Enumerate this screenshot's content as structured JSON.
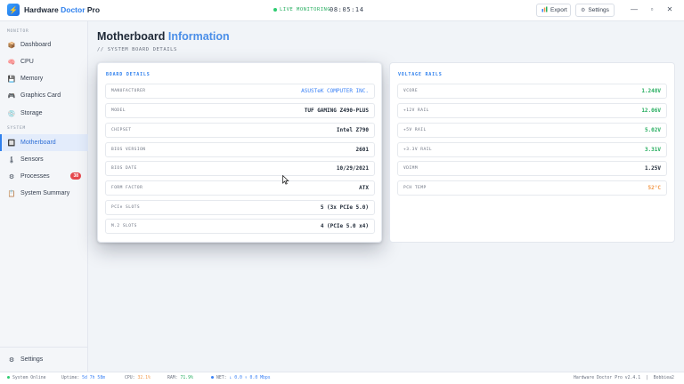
{
  "app": {
    "logo_glyph": "⚡",
    "title_prefix": "Hardware ",
    "title_accent": "Doctor",
    "title_suffix": " Pro",
    "accent_color": "#2f80ed"
  },
  "titlebar": {
    "live_label": "LIVE MONITORING",
    "clock": "08:05:14",
    "export_label": "Export",
    "export_icon": "chart-icon",
    "settings_label": "Settings",
    "settings_icon": "gear-icon",
    "minimize": "—",
    "maximize": "▫",
    "close": "✕"
  },
  "sidebar": {
    "monitor_section": "MONITOR",
    "system_section": "SYSTEM",
    "monitor_items": [
      {
        "label": "Dashboard",
        "icon": "📦"
      },
      {
        "label": "CPU",
        "icon": "🧠"
      },
      {
        "label": "Memory",
        "icon": "💾"
      },
      {
        "label": "Graphics Card",
        "icon": "🎮"
      },
      {
        "label": "Storage",
        "icon": "💿"
      }
    ],
    "system_items": [
      {
        "label": "Motherboard",
        "icon": "🔲",
        "active": true
      },
      {
        "label": "Sensors",
        "icon": "🌡"
      },
      {
        "label": "Processes",
        "icon": "⚙",
        "badge": "38"
      },
      {
        "label": "System Summary",
        "icon": "📋"
      }
    ],
    "settings_label": "Settings",
    "settings_icon": "⚙"
  },
  "main": {
    "title_main": "Motherboard ",
    "title_accent": "Information",
    "subtitle": "// SYSTEM BOARD DETAILS"
  },
  "board_details": {
    "title": "BOARD DETAILS",
    "rows": [
      {
        "label": "MANUFACTURER",
        "value": "ASUSTeK COMPUTER INC."
      },
      {
        "label": "MODEL",
        "value": "TUF GAMING Z490-PLUS"
      },
      {
        "label": "CHIPSET",
        "value": "Intel Z790"
      },
      {
        "label": "BIOS VERSION",
        "value": "2601"
      },
      {
        "label": "BIOS DATE",
        "value": "10/29/2021"
      },
      {
        "label": "FORM FACTOR",
        "value": "ATX"
      },
      {
        "label": "PCIe SLOTS",
        "value": "5 (3x PCIe 5.0)"
      },
      {
        "label": "M.2 SLOTS",
        "value": "4 (PCIe 5.0 x4)"
      }
    ]
  },
  "voltage_rails": {
    "title": "VOLTAGE RAILS",
    "rows": [
      {
        "label": "VCORE",
        "value": "1.248V"
      },
      {
        "label": "+12V RAIL",
        "value": "12.06V"
      },
      {
        "label": "+5V RAIL",
        "value": "5.02V"
      },
      {
        "label": "+3.3V RAIL",
        "value": "3.31V"
      },
      {
        "label": "VDIMM",
        "value": "1.25V"
      },
      {
        "label": "PCH TEMP",
        "value": "52°C"
      }
    ]
  },
  "statusbar": {
    "system_status": "System Online",
    "uptime_label": "Uptime:",
    "uptime_value": "5d 7h 58m",
    "cpu_label": "CPU:",
    "cpu_value": "32.1%",
    "ram_label": "RAM:",
    "ram_value": "71.9%",
    "net_label": "NET:",
    "net_value": "↓ 0.0 ↑ 0.0 Mbps",
    "version": "Hardware Doctor Pro v2.4.1",
    "separator": "|",
    "user": "Bobbiea2"
  }
}
